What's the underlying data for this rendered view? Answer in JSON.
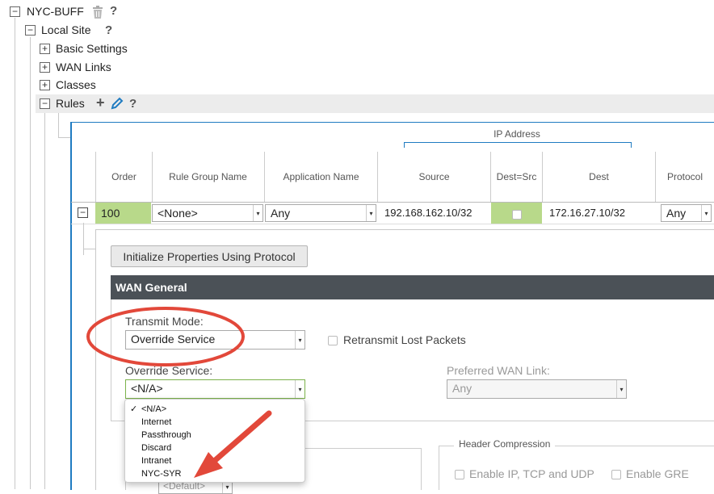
{
  "tree": {
    "root_label": "NYC-BUFF",
    "site_label": "Local Site",
    "items": [
      {
        "label": "Basic Settings",
        "toggle": "+"
      },
      {
        "label": "WAN Links",
        "toggle": "+"
      },
      {
        "label": "Classes",
        "toggle": "+"
      }
    ],
    "rules_label": "Rules",
    "collapse_glyph": "−",
    "help_glyph": "?",
    "add_glyph": "+"
  },
  "table": {
    "group_header": "IP Address",
    "headers": [
      "Order",
      "Rule Group Name",
      "Application Name",
      "Source",
      "Dest=Src",
      "Dest",
      "Protocol"
    ],
    "row": {
      "order": "100",
      "rule_group": "<None>",
      "application": "Any",
      "source": "192.168.162.10/32",
      "dest": "172.16.27.10/32",
      "protocol": "Any"
    }
  },
  "panel": {
    "init_button": "Initialize Properties Using Protocol",
    "section_title": "WAN General",
    "transmit_mode_label": "Transmit Mode:",
    "transmit_mode_value": "Override Service",
    "retransmit_label": "Retransmit Lost Packets",
    "override_service_label": "Override Service:",
    "override_service_value": "<N/A>",
    "preferred_wan_label": "Preferred WAN Link:",
    "preferred_wan_value": "Any",
    "header_compression_label": "Header Compression",
    "enable_ip_label": "Enable IP, TCP and UDP",
    "enable_gre_label": "Enable GRE",
    "default_value": "<Default>"
  },
  "dropdown": {
    "check_glyph": "✓",
    "selected_index": 0,
    "options": [
      "<N/A>",
      "Internet",
      "Passthrough",
      "Discard",
      "Intranet",
      "NYC-SYR"
    ]
  },
  "colors": {
    "accent_blue": "#1f7bc1",
    "section_bar": "#4b5157",
    "annotation_red": "#e2483a",
    "highlight_green": "#b8d98a"
  }
}
